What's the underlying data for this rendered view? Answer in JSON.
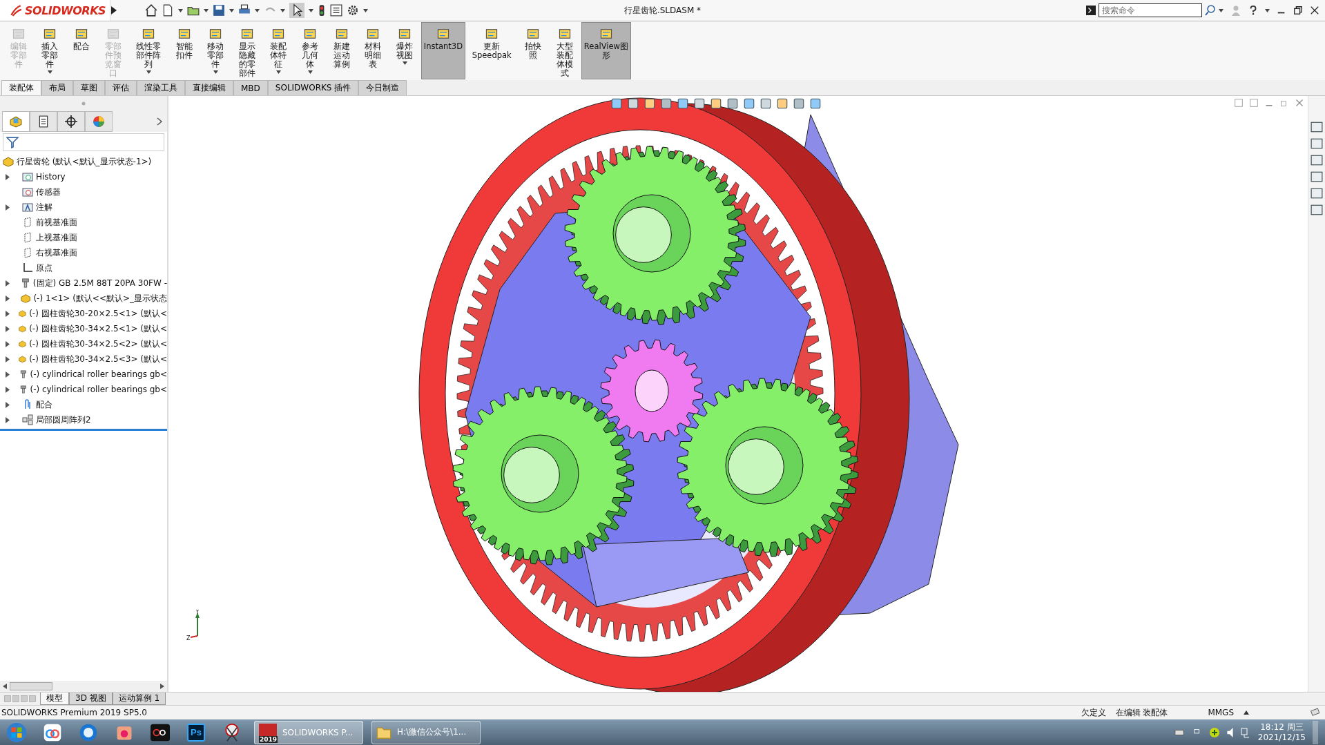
{
  "title_bar": {
    "logo": "SOLIDWORKS",
    "title": "行星齿轮.SLDASM *",
    "search": {
      "placeholder": "搜索命令"
    }
  },
  "command_buttons": [
    {
      "label": "编辑零部件",
      "disabled": true,
      "selected": false,
      "dropdown": false
    },
    {
      "label": "插入零部件",
      "disabled": false,
      "selected": false,
      "dropdown": true
    },
    {
      "label": "配合",
      "disabled": false,
      "selected": false,
      "dropdown": false
    },
    {
      "label": "零部件预览窗口",
      "disabled": true,
      "selected": false,
      "dropdown": false
    },
    {
      "label": "线性零部件阵列",
      "disabled": false,
      "selected": false,
      "dropdown": true
    },
    {
      "label": "智能扣件",
      "disabled": false,
      "selected": false,
      "dropdown": false
    },
    {
      "label": "移动零部件",
      "disabled": false,
      "selected": false,
      "dropdown": true
    },
    {
      "label": "显示隐藏的零部件",
      "disabled": false,
      "selected": false,
      "dropdown": false
    },
    {
      "label": "装配体特征",
      "disabled": false,
      "selected": false,
      "dropdown": true
    },
    {
      "label": "参考几何体",
      "disabled": false,
      "selected": false,
      "dropdown": true
    },
    {
      "label": "新建运动算例",
      "disabled": false,
      "selected": false,
      "dropdown": false
    },
    {
      "label": "材料明细表",
      "disabled": false,
      "selected": false,
      "dropdown": false
    },
    {
      "label": "爆炸视图",
      "disabled": false,
      "selected": false,
      "dropdown": true
    },
    {
      "label": "Instant3D",
      "disabled": false,
      "selected": true,
      "dropdown": false
    },
    {
      "label": "更新Speedpak",
      "disabled": false,
      "selected": false,
      "dropdown": false
    },
    {
      "label": "拍快照",
      "disabled": false,
      "selected": false,
      "dropdown": false
    },
    {
      "label": "大型装配体模式",
      "disabled": false,
      "selected": false,
      "dropdown": false
    },
    {
      "label": "RealView图形",
      "disabled": false,
      "selected": true,
      "dropdown": false
    }
  ],
  "command_tabs": [
    {
      "label": "装配体",
      "selected": true
    },
    {
      "label": "布局",
      "selected": false
    },
    {
      "label": "草图",
      "selected": false
    },
    {
      "label": "评估",
      "selected": false
    },
    {
      "label": "渲染工具",
      "selected": false
    },
    {
      "label": "直接编辑",
      "selected": false
    },
    {
      "label": "MBD",
      "selected": false
    },
    {
      "label": "SOLIDWORKS 插件",
      "selected": false
    },
    {
      "label": "今日制造",
      "selected": false
    }
  ],
  "feature_manager": {
    "tabs": [
      {
        "kind": "tree",
        "selected": true
      },
      {
        "kind": "property",
        "selected": false
      },
      {
        "kind": "config",
        "selected": false
      },
      {
        "kind": "display",
        "selected": false
      }
    ],
    "root": {
      "label": "行星齿轮  (默认<默认_显示状态-1>)",
      "children": [
        {
          "label": "History",
          "kind": "history",
          "expandable": true
        },
        {
          "label": "传感器",
          "kind": "sensor",
          "expandable": false
        },
        {
          "label": "注解",
          "kind": "annotation",
          "expandable": true
        },
        {
          "label": "前视基准面",
          "kind": "plane",
          "expandable": false
        },
        {
          "label": "上视基准面",
          "kind": "plane",
          "expandable": false
        },
        {
          "label": "右视基准面",
          "kind": "plane",
          "expandable": false
        },
        {
          "label": "原点",
          "kind": "origin",
          "expandable": false
        },
        {
          "label": "(固定) GB 2.5M 88T 20PA 30FW -",
          "kind": "bolt",
          "expandable": true
        },
        {
          "label": "(-) 1<1> (默认<<默认>_显示状态",
          "kind": "part",
          "expandable": true
        },
        {
          "label": "(-) 圆柱齿轮30-20×2.5<1> (默认<",
          "kind": "part",
          "expandable": true
        },
        {
          "label": "(-) 圆柱齿轮30-34×2.5<1> (默认<",
          "kind": "part",
          "expandable": true
        },
        {
          "label": "(-) 圆柱齿轮30-34×2.5<2> (默认<",
          "kind": "part",
          "expandable": true
        },
        {
          "label": "(-) 圆柱齿轮30-34×2.5<3> (默认<",
          "kind": "part",
          "expandable": true
        },
        {
          "label": "(-) cylindrical roller bearings gb<",
          "kind": "bolt",
          "expandable": true
        },
        {
          "label": "(-) cylindrical roller bearings gb<",
          "kind": "bolt",
          "expandable": true
        },
        {
          "label": "配合",
          "kind": "mates",
          "expandable": true
        },
        {
          "label": "局部圆周阵列2",
          "kind": "pattern",
          "expandable": true
        }
      ]
    }
  },
  "viewport": {
    "triad": [
      "Y",
      "Z"
    ]
  },
  "bottom_tabs": [
    {
      "label": "模型",
      "selected": true
    },
    {
      "label": "3D 视图",
      "selected": false
    },
    {
      "label": "运动算例 1",
      "selected": false
    }
  ],
  "status_bar": {
    "product": "SOLIDWORKS Premium 2019 SP5.0",
    "state": "欠定义",
    "mode": "在编辑 装配体",
    "units": "MMGS"
  },
  "taskbar": {
    "pinned": [
      {
        "kind": "cloud"
      },
      {
        "kind": "lens"
      },
      {
        "kind": "box"
      },
      {
        "kind": "record"
      },
      {
        "kind": "ps",
        "text": "Ps"
      },
      {
        "kind": "scissors"
      }
    ],
    "apps": [
      {
        "label": "SOLIDWORKS P...",
        "kind": "solidworks",
        "badge": "2019",
        "selected": true
      },
      {
        "label": "H:\\微信公众号\\1...",
        "kind": "folder",
        "selected": false
      }
    ],
    "time": "18:12 周三",
    "date": "2021/12/15"
  }
}
